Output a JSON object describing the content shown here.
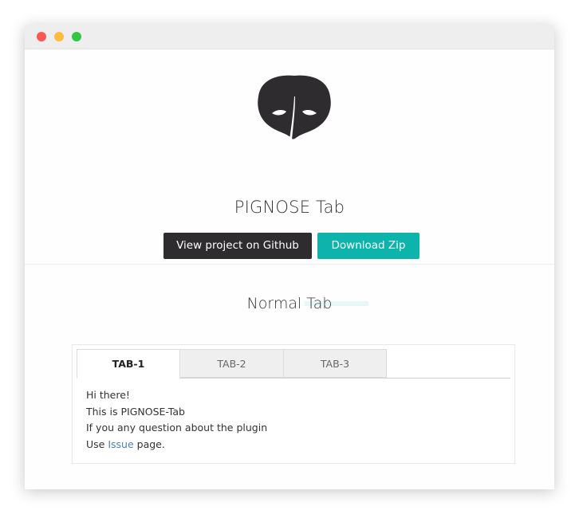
{
  "window": {
    "controls": [
      "close",
      "minimize",
      "maximize"
    ]
  },
  "hero": {
    "logo_icon": "pignose-mask-icon",
    "title": "PIGNOSE Tab",
    "buttons": {
      "github": "View project on Github",
      "zip": "Download Zip"
    }
  },
  "section": {
    "title": "Normal Tab"
  },
  "tabs": [
    {
      "label": "TAB-1",
      "active": true
    },
    {
      "label": "TAB-2",
      "active": false
    },
    {
      "label": "TAB-3",
      "active": false
    }
  ],
  "content": {
    "line1": "Hi there!",
    "line2": "This is PIGNOSE-Tab",
    "line3": "If you any question about the plugin",
    "line4_prefix": "Use ",
    "line4_link": "Issue",
    "line4_suffix": " page."
  },
  "colors": {
    "dark_button": "#2e2c2f",
    "accent": "#0cb4ac",
    "link": "#4a7fc0",
    "close_dot": "#fc5753",
    "minimize_dot": "#fdbc40",
    "maximize_dot": "#33c748"
  }
}
